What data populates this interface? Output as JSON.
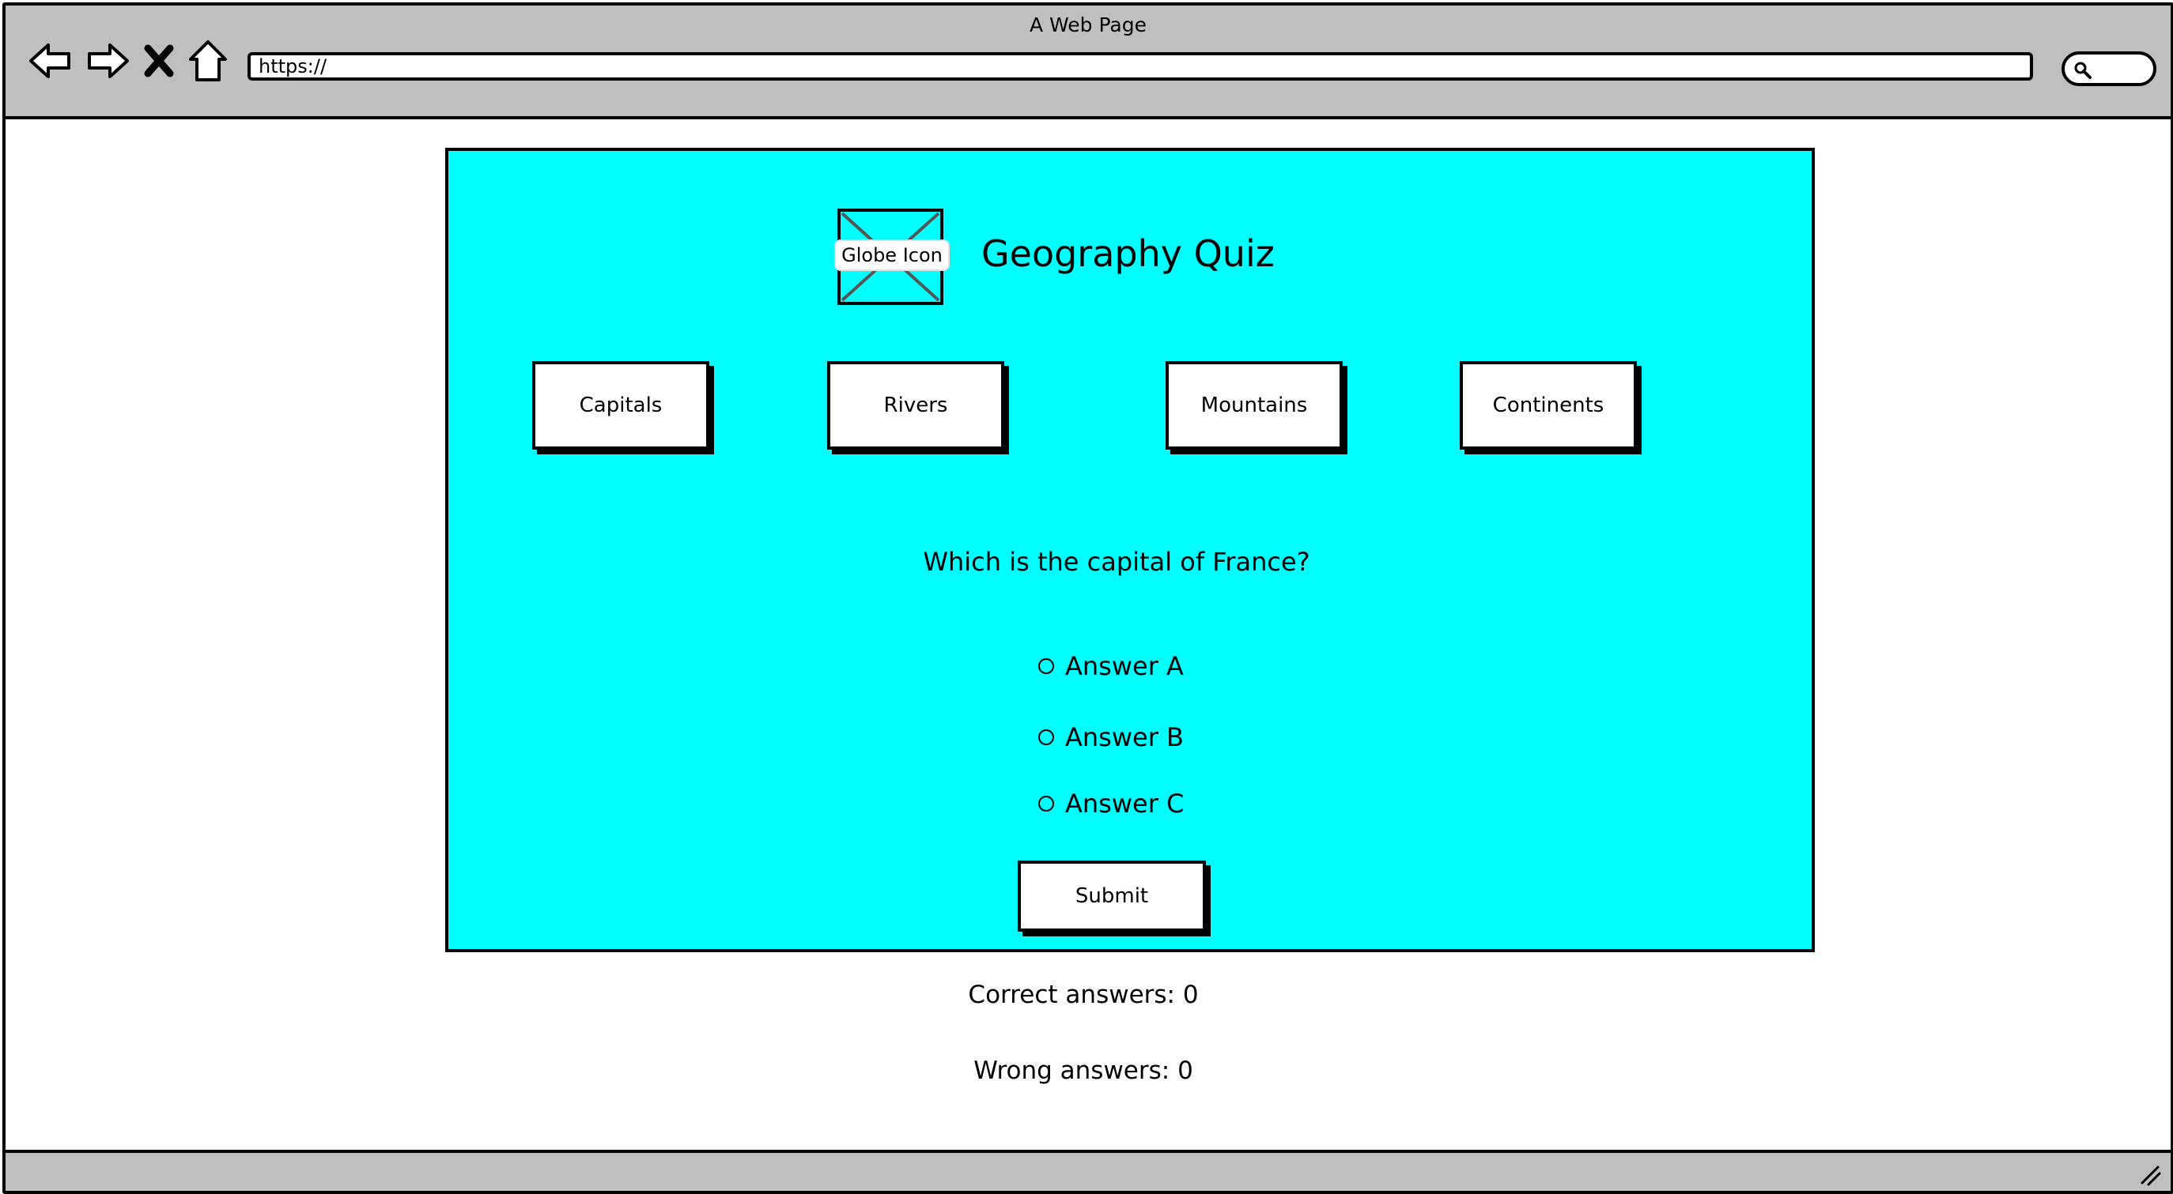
{
  "browser": {
    "title": "A Web Page",
    "url": "https://"
  },
  "quiz": {
    "icon_label": "Globe Icon",
    "title": "Geography Quiz",
    "categories": [
      "Capitals",
      "Rivers",
      "Mountains",
      "Continents"
    ],
    "question": "Which is the capital of France?",
    "answers": [
      "Answer A",
      "Answer B",
      "Answer C"
    ],
    "submit_label": "Submit",
    "background_color": "#00ffff"
  },
  "score": {
    "correct": "Correct answers: 0",
    "wrong": "Wrong answers: 0"
  }
}
